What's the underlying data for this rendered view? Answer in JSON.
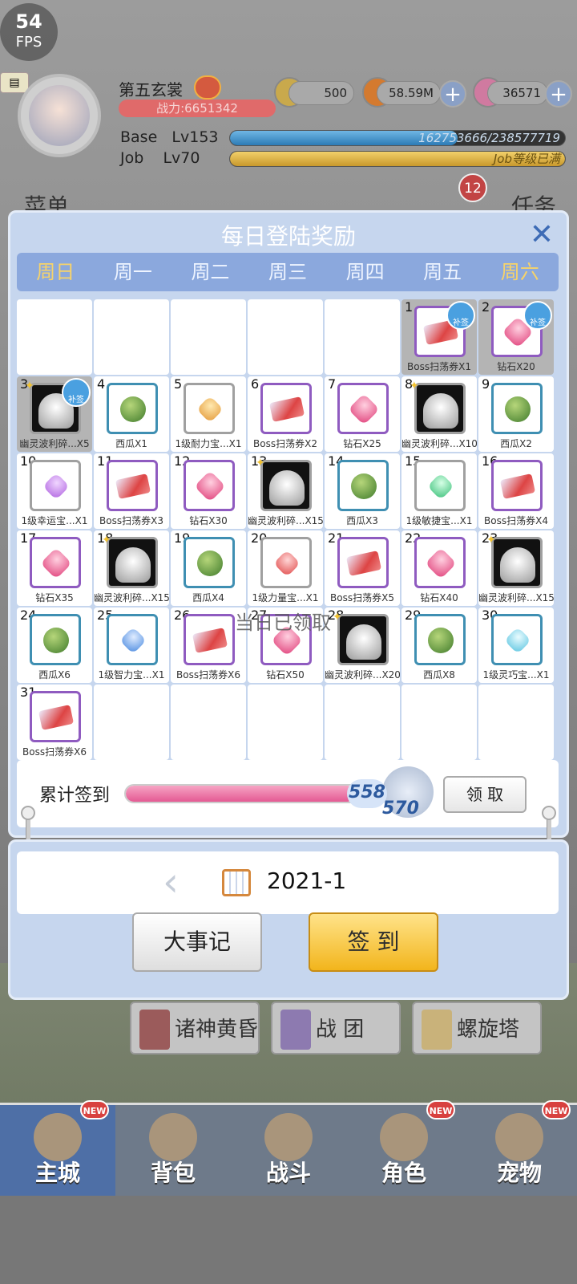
{
  "hud": {
    "fps_value": "54",
    "fps_label": "FPS",
    "player_name": "第五玄裳",
    "combat_power": "战力:6651342",
    "currency_1": "500",
    "currency_2": "58.59M",
    "currency_3": "36571",
    "base_label": "Base",
    "base_level": "Lv153",
    "base_exp": "162753666/238577719",
    "job_label": "Job",
    "job_level": "Lv70",
    "job_exp": "Job等级已满",
    "menu_left": "菜单",
    "menu_right": "任务",
    "quest_badge": "12"
  },
  "modal": {
    "title": "每日登陆奖励",
    "weekdays": [
      "周日",
      "周一",
      "周二",
      "周三",
      "周四",
      "周五",
      "周六"
    ],
    "overlay_text": "当日已领取",
    "cells": [
      {
        "day": "",
        "label": "",
        "item": "empty"
      },
      {
        "day": "",
        "label": "",
        "item": "empty"
      },
      {
        "day": "",
        "label": "",
        "item": "empty"
      },
      {
        "day": "",
        "label": "",
        "item": "empty"
      },
      {
        "day": "",
        "label": "",
        "item": "empty"
      },
      {
        "day": "1",
        "label": "Boss扫荡券X1",
        "item": "ticket",
        "claimed": true,
        "makeup": true
      },
      {
        "day": "2",
        "label": "钻石X20",
        "item": "gem",
        "claimed": true,
        "makeup": true
      },
      {
        "day": "3",
        "label": "幽灵波利碎...X5",
        "item": "ghost",
        "claimed": true,
        "makeup": true,
        "star": true
      },
      {
        "day": "4",
        "label": "西瓜X1",
        "item": "melon"
      },
      {
        "day": "5",
        "label": "1级耐力宝...X1",
        "item": "orange"
      },
      {
        "day": "6",
        "label": "Boss扫荡券X2",
        "item": "ticket"
      },
      {
        "day": "7",
        "label": "钻石X25",
        "item": "gem"
      },
      {
        "day": "8",
        "label": "幽灵波利碎...X10",
        "item": "ghost",
        "star": true
      },
      {
        "day": "9",
        "label": "西瓜X2",
        "item": "melon"
      },
      {
        "day": "10",
        "label": "1级幸运宝...X1",
        "item": "purple"
      },
      {
        "day": "11",
        "label": "Boss扫荡券X3",
        "item": "ticket"
      },
      {
        "day": "12",
        "label": "钻石X30",
        "item": "gem"
      },
      {
        "day": "13",
        "label": "幽灵波利碎...X15",
        "item": "ghost",
        "star": true
      },
      {
        "day": "14",
        "label": "西瓜X3",
        "item": "melon"
      },
      {
        "day": "15",
        "label": "1级敏捷宝...X1",
        "item": "green"
      },
      {
        "day": "16",
        "label": "Boss扫荡券X4",
        "item": "ticket"
      },
      {
        "day": "17",
        "label": "钻石X35",
        "item": "gem"
      },
      {
        "day": "18",
        "label": "幽灵波利碎...X15",
        "item": "ghost",
        "star": true
      },
      {
        "day": "19",
        "label": "西瓜X4",
        "item": "melon"
      },
      {
        "day": "20",
        "label": "1级力量宝...X1",
        "item": "red"
      },
      {
        "day": "21",
        "label": "Boss扫荡券X5",
        "item": "ticket"
      },
      {
        "day": "22",
        "label": "钻石X40",
        "item": "gem"
      },
      {
        "day": "23",
        "label": "幽灵波利碎...X15",
        "item": "ghost",
        "star": true
      },
      {
        "day": "24",
        "label": "西瓜X6",
        "item": "melon"
      },
      {
        "day": "25",
        "label": "1级智力宝...X1",
        "item": "blue"
      },
      {
        "day": "26",
        "label": "Boss扫荡券X6",
        "item": "ticket"
      },
      {
        "day": "27",
        "label": "钻石X50",
        "item": "gem"
      },
      {
        "day": "28",
        "label": "幽灵波利碎...X20",
        "item": "ghost",
        "star": true
      },
      {
        "day": "29",
        "label": "西瓜X8",
        "item": "melon"
      },
      {
        "day": "30",
        "label": "1级灵巧宝...X1",
        "item": "cyan"
      },
      {
        "day": "31",
        "label": "Boss扫荡券X6",
        "item": "ticket"
      },
      {
        "day": "",
        "label": "",
        "item": "empty"
      },
      {
        "day": "",
        "label": "",
        "item": "empty"
      },
      {
        "day": "",
        "label": "",
        "item": "empty"
      },
      {
        "day": "",
        "label": "",
        "item": "empty"
      },
      {
        "day": "",
        "label": "",
        "item": "empty"
      },
      {
        "day": "",
        "label": "",
        "item": "empty"
      }
    ],
    "makeup_label": "补签",
    "cumulative": {
      "label": "累计签到",
      "current": "558",
      "goal": "570",
      "progress_ratio": 0.979,
      "claim_label": "领 取"
    }
  },
  "calendar": {
    "prev_label": "‹",
    "month": "2021-1"
  },
  "actions": {
    "events_label": "大事记",
    "sign_label": "签 到"
  },
  "features": {
    "f1": "诸神黄昏",
    "f2": "战 团",
    "f3": "螺旋塔"
  },
  "nav": {
    "tabs": [
      {
        "label": "主城",
        "new": true,
        "active": true
      },
      {
        "label": "背包",
        "new": false,
        "active": false
      },
      {
        "label": "战斗",
        "new": false,
        "active": false
      },
      {
        "label": "角色",
        "new": true,
        "active": false
      },
      {
        "label": "宠物",
        "new": true,
        "active": false
      }
    ],
    "new_label": "NEW"
  }
}
